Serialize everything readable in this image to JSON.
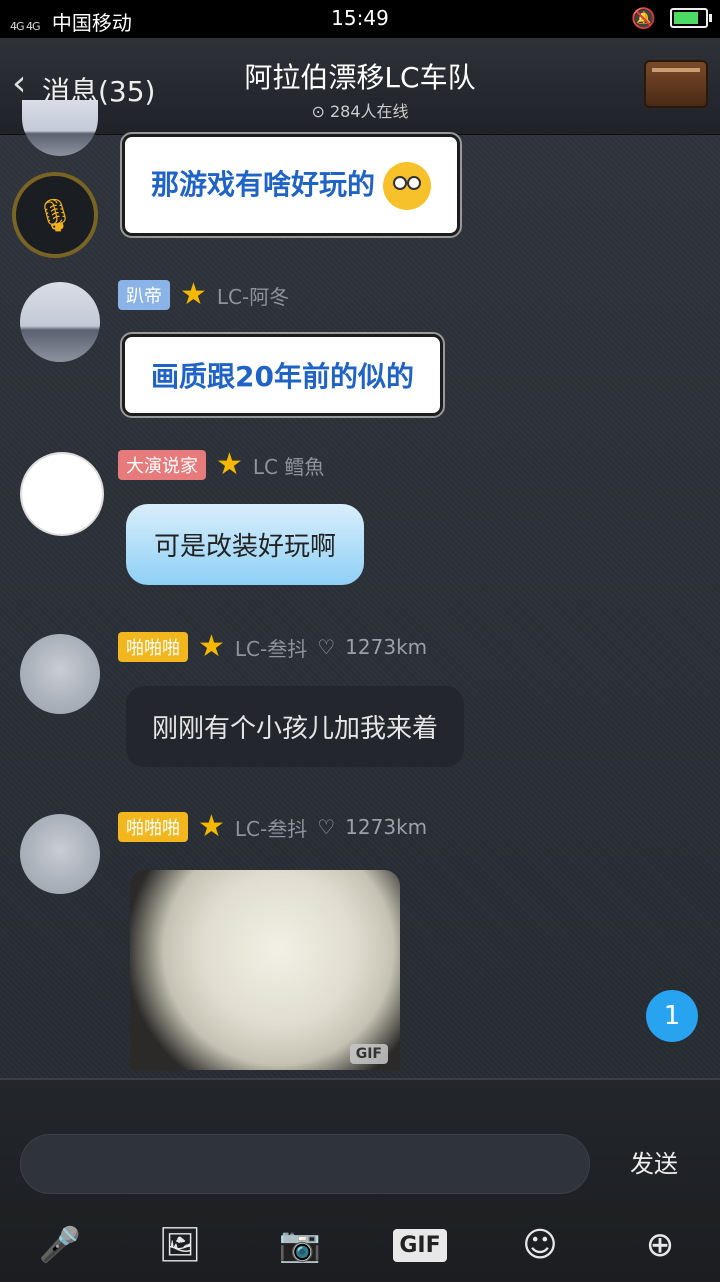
{
  "status": {
    "carrier": "中国移动",
    "network": "4G 4G",
    "time": "15:49"
  },
  "header": {
    "back_label": "消息(35)",
    "title": "阿拉伯漂移LC车队",
    "online": "284人在线"
  },
  "messages": [
    {
      "text": "那游戏有啥好玩的"
    },
    {
      "badge": "趴帝",
      "name": "LC-阿冬",
      "text": "画质跟20年前的似的"
    },
    {
      "badge": "大演说家",
      "name": "LC 鳕魚",
      "text": "可是改装好玩啊"
    },
    {
      "badge": "啪啪啪",
      "name": "LC-叁抖",
      "distance": "1273km",
      "text": "刚刚有个小孩儿加我来着"
    },
    {
      "badge": "啪啪啪",
      "name": "LC-叁抖",
      "distance": "1273km",
      "gif_label": "GIF"
    }
  ],
  "unread_count": "1",
  "composer": {
    "send_label": "发送",
    "gif_label": "GIF"
  },
  "colors": {
    "accent_blue": "#27a3f0",
    "badge_yellow": "#f2b71f",
    "badge_red": "#e77b7b",
    "badge_blue": "#8ab4e8"
  }
}
